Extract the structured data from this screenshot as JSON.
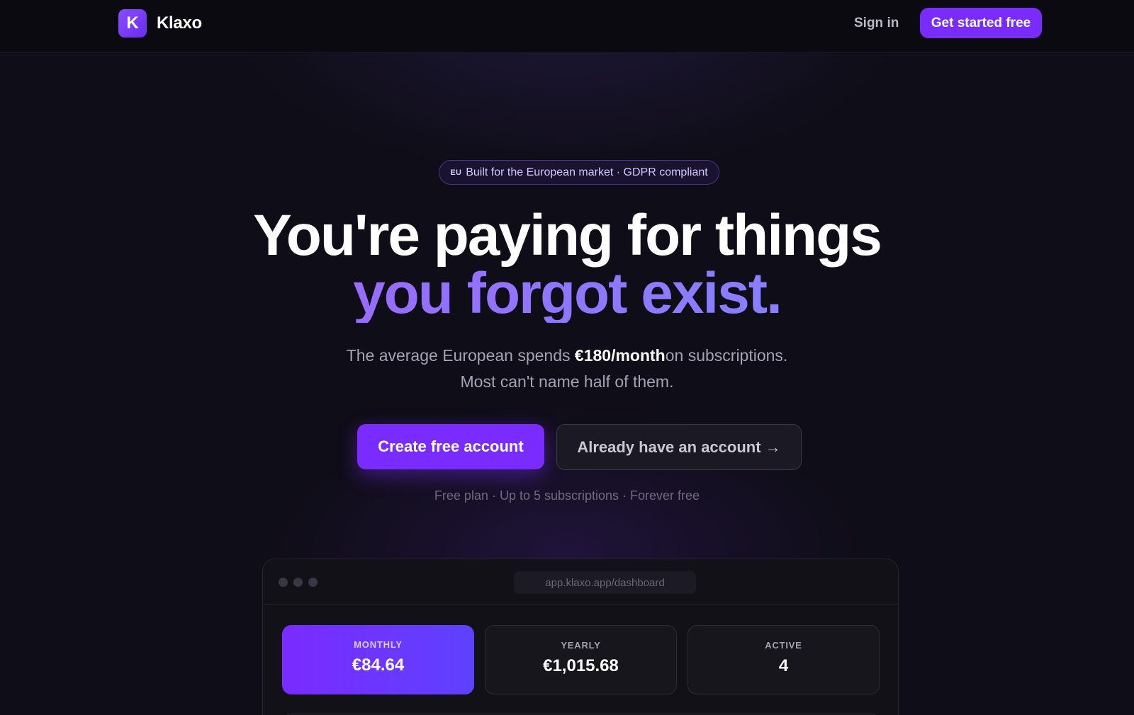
{
  "nav": {
    "brand_initial": "K",
    "brand_name": "Klaxo",
    "signin_label": "Sign in",
    "cta_label": "Get started free"
  },
  "hero": {
    "badge_eu": "EU",
    "badge_text": "Built for the European market · GDPR compliant",
    "headline_line1": "You're paying for things",
    "headline_line2": "you forgot exist.",
    "sub_prefix": "The average European spends ",
    "sub_amount": "€180/month",
    "sub_suffix": "on subscriptions.",
    "sub_line2": "Most can't name half of them.",
    "primary_button": "Create free account",
    "secondary_button": "Already have an account →",
    "fine_print": "Free plan · Up to 5 subscriptions · Forever free"
  },
  "preview": {
    "url": "app.klaxo.app/dashboard",
    "stats": [
      {
        "label": "MONTHLY",
        "value": "€84.64"
      },
      {
        "label": "YEARLY",
        "value": "€1,015.68"
      },
      {
        "label": "ACTIVE",
        "value": "4"
      }
    ]
  },
  "colors": {
    "accent": "#7a2bff",
    "background": "#0f0d17",
    "gradient_start": "#a45cff",
    "gradient_end": "#7d8bff"
  }
}
